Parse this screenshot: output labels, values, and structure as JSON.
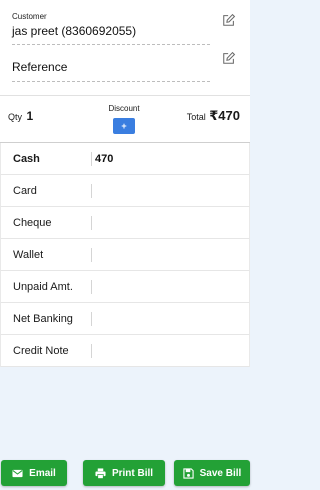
{
  "customer": {
    "label": "Customer",
    "value": "jas preet (8360692055)"
  },
  "reference": {
    "label": "Reference",
    "value": ""
  },
  "summary": {
    "qty_label": "Qty",
    "qty_value": "1",
    "discount_label": "Discount",
    "discount_button": "+",
    "total_label": "Total",
    "total_value": "₹470"
  },
  "payments": [
    {
      "label": "Cash",
      "value": "470"
    },
    {
      "label": "Card",
      "value": ""
    },
    {
      "label": "Cheque",
      "value": ""
    },
    {
      "label": "Wallet",
      "value": ""
    },
    {
      "label": "Unpaid Amt.",
      "value": ""
    },
    {
      "label": "Net Banking",
      "value": ""
    },
    {
      "label": "Credit Note",
      "value": ""
    }
  ],
  "actions": {
    "email": "Email",
    "print": "Print Bill",
    "save": "Save Bill"
  },
  "colors": {
    "action_green": "#23a136",
    "discount_blue": "#3a7ee0",
    "page_bg": "#ecf3fb"
  },
  "icons": {
    "edit": "edit-icon",
    "email": "envelope-icon",
    "print": "printer-icon",
    "save": "floppy-disk-icon"
  }
}
